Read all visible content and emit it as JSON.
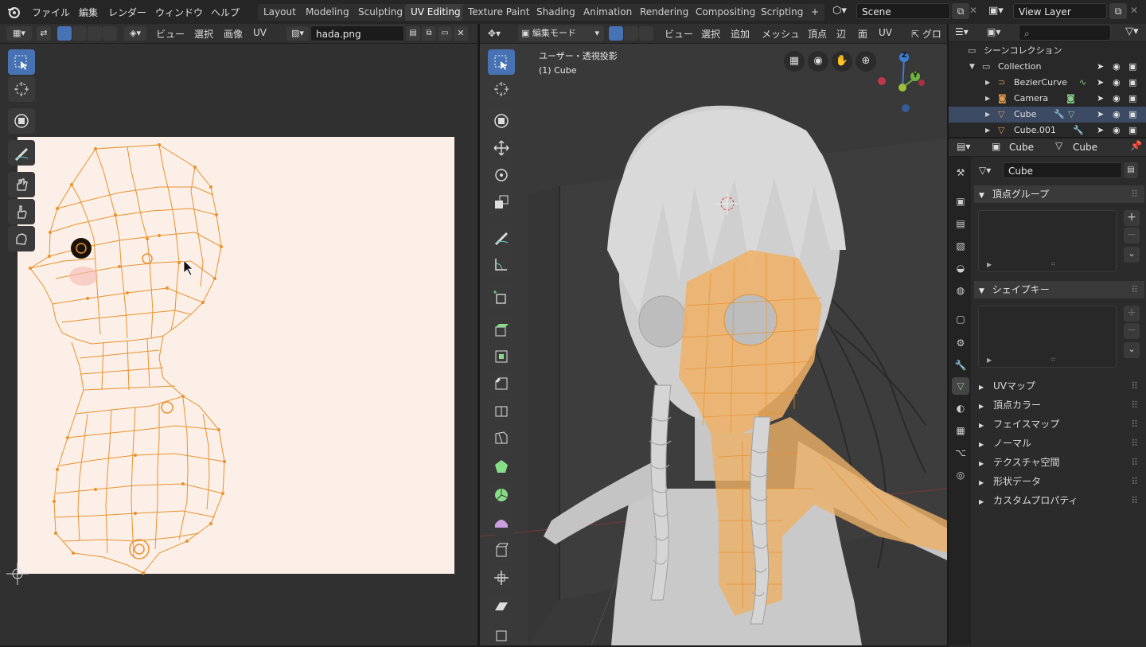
{
  "topbar": {
    "menus": [
      "ファイル",
      "編集",
      "レンダー",
      "ウィンドウ",
      "ヘルプ"
    ],
    "workspaces": [
      "Layout",
      "Modeling",
      "Sculpting",
      "UV Editing",
      "Texture Paint",
      "Shading",
      "Animation",
      "Rendering",
      "Compositing",
      "Scripting"
    ],
    "active_workspace": "UV Editing",
    "add_tab": "+",
    "scene": "Scene",
    "view_layer": "View Layer"
  },
  "uv_editor": {
    "menus": [
      "ビュー",
      "選択",
      "画像",
      "UV"
    ],
    "image_name": "hada.png",
    "canvas_color": "#fcefe7"
  },
  "viewport": {
    "mode": "編集モード",
    "menus": [
      "ビュー",
      "選択",
      "追加",
      "メッシュ",
      "頂点",
      "辺",
      "面",
      "UV"
    ],
    "overflow_label": "グロ",
    "view_name": "ユーザー・透視投影",
    "object_label": "(1) Cube",
    "gizmo": {
      "z": "Z",
      "y": "Y"
    }
  },
  "outliner": {
    "title": "シーンコレクション",
    "collection": "Collection",
    "items": [
      "BezierCurve",
      "Camera",
      "Cube",
      "Cube.001"
    ],
    "selected": "Cube"
  },
  "properties": {
    "object_name": "Cube",
    "mesh_name": "Cube",
    "data_field": "Cube",
    "panels": {
      "vertex_groups": "頂点グループ",
      "shape_keys": "シェイプキー"
    },
    "sections": [
      "UVマップ",
      "頂点カラー",
      "フェイスマップ",
      "ノーマル",
      "テクスチャ空間",
      "形状データ",
      "カスタムプロパティ"
    ]
  },
  "colors": {
    "accent": "#4772b3",
    "uv_wire": "#e8922e",
    "selection": "#f0a040"
  }
}
